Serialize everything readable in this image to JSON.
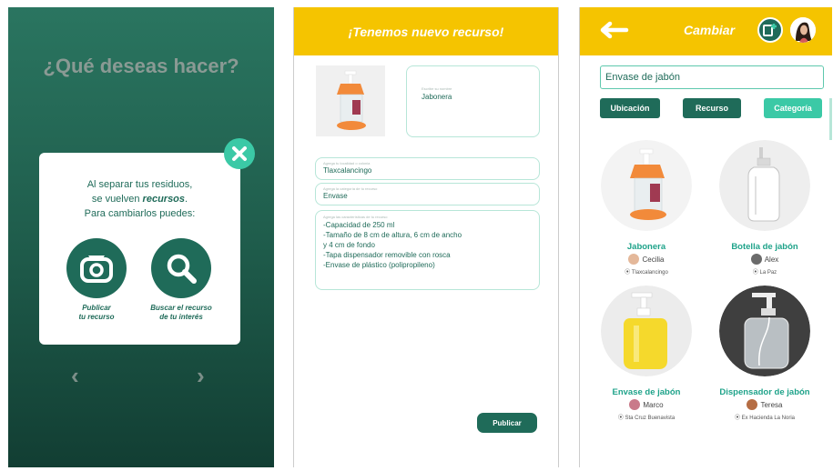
{
  "screen1": {
    "title": "¿Qué deseas hacer?",
    "intro_line1": "Al separar tus residuos,",
    "intro_line2_prefix": "se vuelven ",
    "intro_line2_emphasis": "recursos",
    "intro_line2_suffix": ".",
    "intro_line3": "Para cambiarlos puedes:",
    "action_publish_line1": "Publicar",
    "action_publish_line2": "tu recurso",
    "action_search_line1": "Buscar el recurso",
    "action_search_line2": "de tu interés",
    "prev_arrow": "‹",
    "next_arrow": "›"
  },
  "screen2": {
    "header_title": "¡Tenemos nuevo recurso!",
    "name_hint": "Escribe su nombre",
    "name_value": "Jabonera",
    "location_hint": "Agrega tu localidad o colonia",
    "location_value": "Tlaxcalancingo",
    "category_hint": "Agrega la categoría de tu recurso",
    "category_value": "Envase",
    "features_hint": "Agrega las características de tu recurso",
    "features_lines": [
      "-Capacidad de 250 ml",
      "-Tamaño de 8 cm de altura, 6 cm de ancho",
      "y 4 cm de fondo",
      "-Tapa dispensador removible con rosca",
      "-Envase de plástico (polipropileno)"
    ],
    "publish_label": "Publicar"
  },
  "screen3": {
    "header_title": "Cambiar",
    "search_value": "Envase de jabón",
    "filters": [
      "Ubicación",
      "Recurso",
      "Categoría"
    ],
    "products": [
      {
        "name": "Jabonera",
        "user": "Cecilia",
        "location": "Tlaxcalancingo"
      },
      {
        "name": "Botella de jabón",
        "user": "Alex",
        "location": "La Paz"
      },
      {
        "name": "Envase de jabón",
        "user": "Marco",
        "location": "Sta Cruz Buenavista"
      },
      {
        "name": "Dispensador de jabón",
        "user": "Teresa",
        "location": "Ex Hacienda La Noria"
      }
    ]
  },
  "colors": {
    "dark_green": "#1f6b59",
    "mint": "#3bc9a6",
    "yellow": "#f5c400",
    "teal_text": "#1fa38a"
  }
}
